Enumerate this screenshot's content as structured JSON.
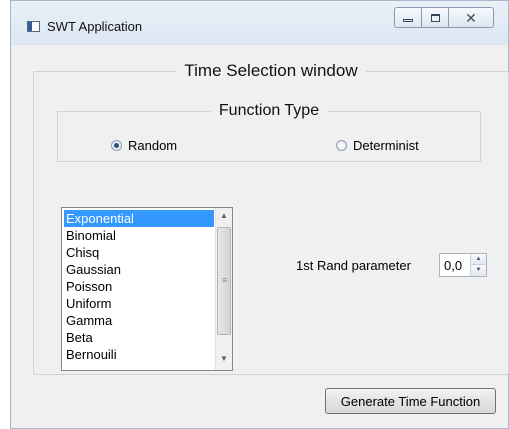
{
  "window": {
    "title": "SWT Application",
    "controls": {
      "minimize": "minimize-icon",
      "maximize": "maximize-icon",
      "close": "close-icon"
    }
  },
  "outer_group": {
    "legend": "Time Selection window"
  },
  "function_type": {
    "legend": "Function Type",
    "options": [
      {
        "label": "Random",
        "selected": true
      },
      {
        "label": "Determinist",
        "selected": false
      }
    ]
  },
  "distribution_list": {
    "items": [
      "Exponential",
      "Binomial",
      "Chisq",
      "Gaussian",
      "Poisson",
      "Uniform",
      "Gamma",
      "Beta",
      "Bernouili"
    ],
    "selected": "Exponential"
  },
  "parameter": {
    "label": "1st Rand parameter",
    "value": "0,0"
  },
  "generate_button": {
    "label": "Generate Time Function"
  }
}
